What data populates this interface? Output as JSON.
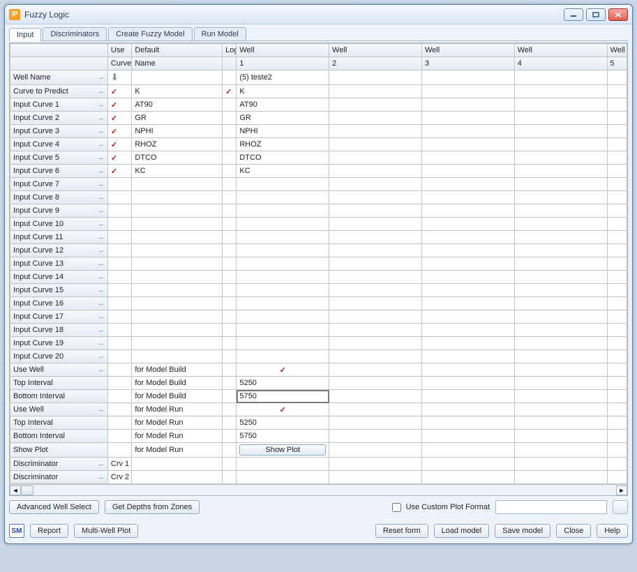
{
  "window": {
    "title": "Fuzzy Logic",
    "app_icon_text": "IP"
  },
  "tabs": [
    "Input",
    "Discriminators",
    "Create Fuzzy Model",
    "Run Model"
  ],
  "active_tab": 0,
  "grid": {
    "header1": {
      "rowlabel": "",
      "use": "Use",
      "default": "Default",
      "log": "Log",
      "wells": [
        "Well",
        "Well",
        "Well",
        "Well",
        "Well"
      ]
    },
    "header2": {
      "rowlabel": "",
      "use": "Curve",
      "default": "Name",
      "log": "",
      "wells": [
        "1",
        "2",
        "3",
        "4",
        "5"
      ]
    },
    "rows": [
      {
        "label": "Well Name",
        "arrow": true,
        "use": "down",
        "default": "",
        "log": "",
        "wells": [
          "(5) teste2",
          "",
          "",
          "",
          ""
        ]
      },
      {
        "label": "Curve to Predict",
        "arrow": true,
        "use": "check",
        "default": "K",
        "log": "check",
        "wells": [
          "K",
          "",
          "",
          "",
          ""
        ]
      },
      {
        "label": "Input Curve 1",
        "arrow": true,
        "use": "check",
        "default": "AT90",
        "log": "",
        "wells": [
          "AT90",
          "",
          "",
          "",
          ""
        ]
      },
      {
        "label": "Input Curve 2",
        "arrow": true,
        "use": "check",
        "default": "GR",
        "log": "",
        "wells": [
          "GR",
          "",
          "",
          "",
          ""
        ]
      },
      {
        "label": "Input Curve 3",
        "arrow": true,
        "use": "check",
        "default": "NPHI",
        "log": "",
        "wells": [
          "NPHI",
          "",
          "",
          "",
          ""
        ]
      },
      {
        "label": "Input Curve 4",
        "arrow": true,
        "use": "check",
        "default": "RHOZ",
        "log": "",
        "wells": [
          "RHOZ",
          "",
          "",
          "",
          ""
        ]
      },
      {
        "label": "Input Curve 5",
        "arrow": true,
        "use": "check",
        "default": "DTCO",
        "log": "",
        "wells": [
          "DTCO",
          "",
          "",
          "",
          ""
        ]
      },
      {
        "label": "Input Curve 6",
        "arrow": true,
        "use": "check",
        "default": "KC",
        "log": "",
        "wells": [
          "KC",
          "",
          "",
          "",
          ""
        ]
      },
      {
        "label": "Input Curve 7",
        "arrow": true,
        "use": "",
        "default": "",
        "log": "",
        "wells": [
          "",
          "",
          "",
          "",
          ""
        ]
      },
      {
        "label": "Input Curve 8",
        "arrow": true,
        "use": "",
        "default": "",
        "log": "",
        "wells": [
          "",
          "",
          "",
          "",
          ""
        ]
      },
      {
        "label": "Input Curve 9",
        "arrow": true,
        "use": "",
        "default": "",
        "log": "",
        "wells": [
          "",
          "",
          "",
          "",
          ""
        ]
      },
      {
        "label": "Input Curve 10",
        "arrow": true,
        "use": "",
        "default": "",
        "log": "",
        "wells": [
          "",
          "",
          "",
          "",
          ""
        ]
      },
      {
        "label": "Input Curve 11",
        "arrow": true,
        "use": "",
        "default": "",
        "log": "",
        "wells": [
          "",
          "",
          "",
          "",
          ""
        ]
      },
      {
        "label": "Input Curve 12",
        "arrow": true,
        "use": "",
        "default": "",
        "log": "",
        "wells": [
          "",
          "",
          "",
          "",
          ""
        ]
      },
      {
        "label": "Input Curve 13",
        "arrow": true,
        "use": "",
        "default": "",
        "log": "",
        "wells": [
          "",
          "",
          "",
          "",
          ""
        ]
      },
      {
        "label": "Input Curve 14",
        "arrow": true,
        "use": "",
        "default": "",
        "log": "",
        "wells": [
          "",
          "",
          "",
          "",
          ""
        ]
      },
      {
        "label": "Input Curve 15",
        "arrow": true,
        "use": "",
        "default": "",
        "log": "",
        "wells": [
          "",
          "",
          "",
          "",
          ""
        ]
      },
      {
        "label": "Input Curve 16",
        "arrow": true,
        "use": "",
        "default": "",
        "log": "",
        "wells": [
          "",
          "",
          "",
          "",
          ""
        ]
      },
      {
        "label": "Input Curve 17",
        "arrow": true,
        "use": "",
        "default": "",
        "log": "",
        "wells": [
          "",
          "",
          "",
          "",
          ""
        ]
      },
      {
        "label": "Input Curve 18",
        "arrow": true,
        "use": "",
        "default": "",
        "log": "",
        "wells": [
          "",
          "",
          "",
          "",
          ""
        ]
      },
      {
        "label": "Input Curve 19",
        "arrow": true,
        "use": "",
        "default": "",
        "log": "",
        "wells": [
          "",
          "",
          "",
          "",
          ""
        ]
      },
      {
        "label": "Input Curve 20",
        "arrow": true,
        "use": "",
        "default": "",
        "log": "",
        "wells": [
          "",
          "",
          "",
          "",
          ""
        ]
      },
      {
        "label": "Use Well",
        "arrow": true,
        "use": "",
        "default": "for Model Build",
        "log": "",
        "wells": [
          "check",
          "",
          "",
          "",
          ""
        ],
        "well1_center": true
      },
      {
        "label": "Top Interval",
        "arrow": false,
        "use": "",
        "default": "for Model Build",
        "log": "",
        "wells": [
          "5250",
          "",
          "",
          "",
          ""
        ]
      },
      {
        "label": "Bottom Interval",
        "arrow": false,
        "use": "",
        "default": "for Model Build",
        "log": "",
        "wells": [
          "5750",
          "",
          "",
          "",
          ""
        ],
        "selected": true
      },
      {
        "label": "Use Well",
        "arrow": true,
        "use": "",
        "default": "for Model Run",
        "log": "",
        "wells": [
          "check",
          "",
          "",
          "",
          ""
        ],
        "well1_center": true
      },
      {
        "label": "Top Interval",
        "arrow": false,
        "use": "",
        "default": "for Model Run",
        "log": "",
        "wells": [
          "5250",
          "",
          "",
          "",
          ""
        ]
      },
      {
        "label": "Bottom Interval",
        "arrow": false,
        "use": "",
        "default": "for Model Run",
        "log": "",
        "wells": [
          "5750",
          "",
          "",
          "",
          ""
        ]
      },
      {
        "label": "Show Plot",
        "arrow": false,
        "use": "",
        "default": "for Model Run",
        "log": "",
        "wells": [
          "Show Plot",
          "",
          "",
          "",
          ""
        ],
        "well1_button": true
      },
      {
        "label": "Discriminator",
        "arrow": true,
        "use": "Crv 1",
        "use_text": true,
        "default": "",
        "log": "",
        "wells": [
          "",
          "",
          "",
          "",
          ""
        ]
      },
      {
        "label": "Discriminator",
        "arrow": true,
        "use": "Crv 2",
        "use_text": true,
        "default": "",
        "log": "",
        "wells": [
          "",
          "",
          "",
          "",
          ""
        ]
      }
    ]
  },
  "under_grid": {
    "advanced": "Advanced Well Select",
    "depths": "Get Depths from Zones",
    "custom_plot": "Use Custom Plot Format"
  },
  "bottom": {
    "sm": "SM",
    "report": "Report",
    "multiwell": "Multi-Well Plot",
    "reset": "Reset form",
    "load": "Load model",
    "save": "Save model",
    "close": "Close",
    "help": "Help"
  }
}
